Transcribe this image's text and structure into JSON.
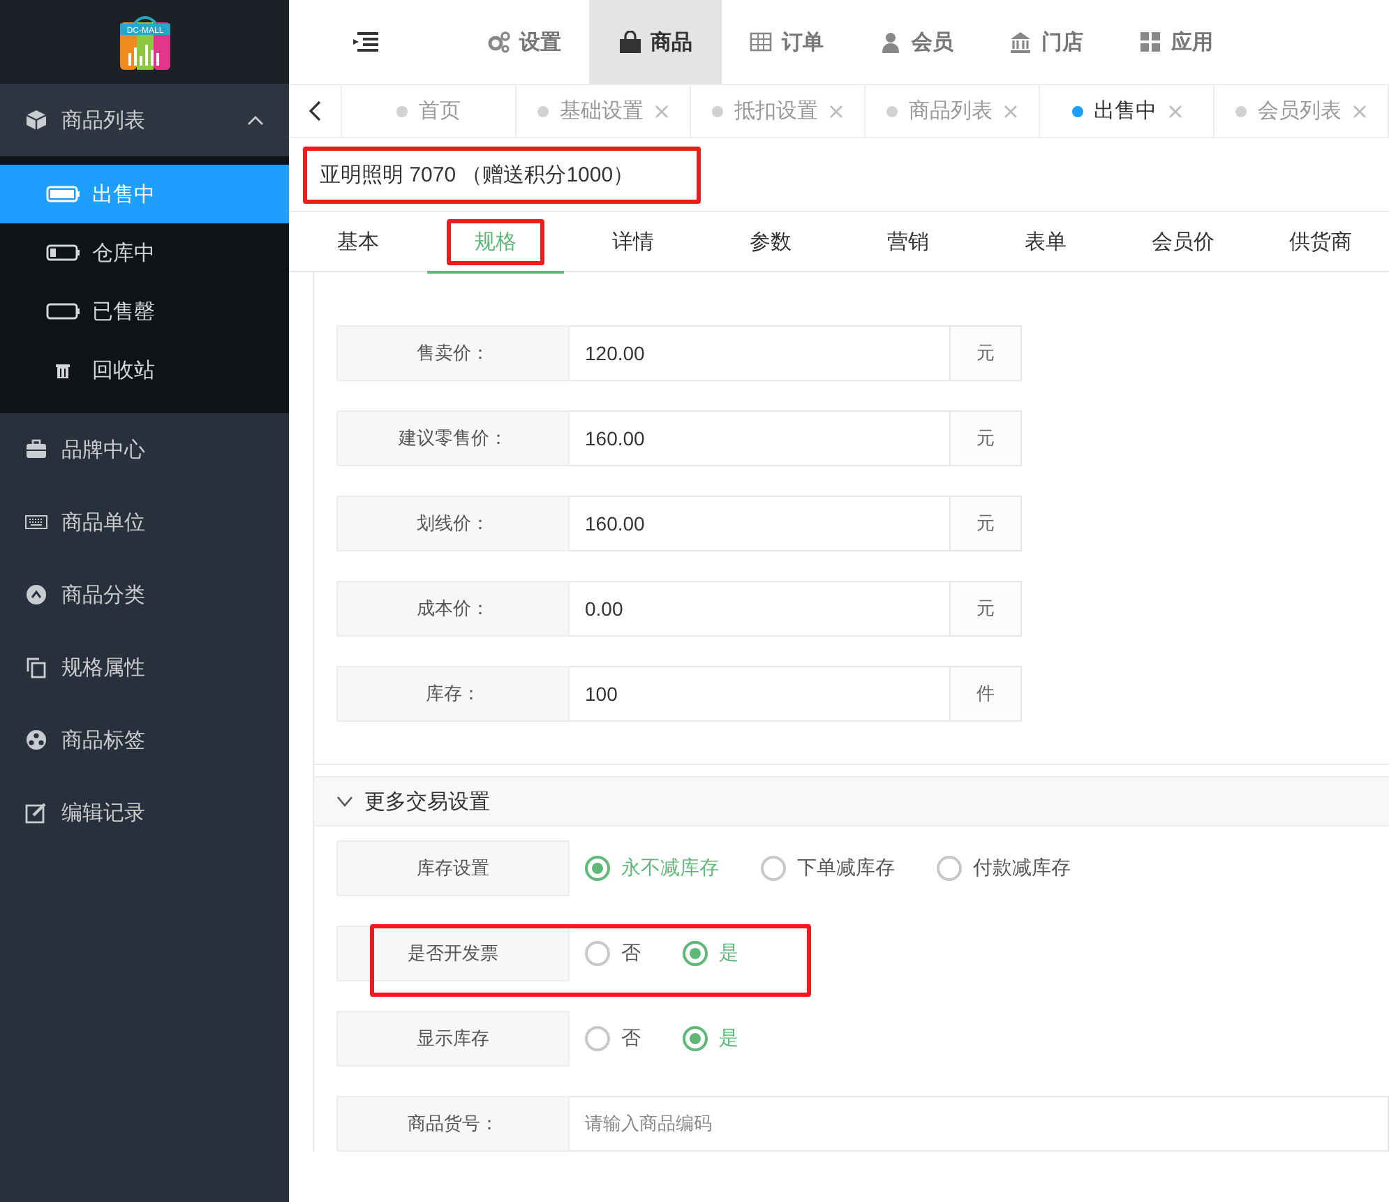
{
  "logo": {
    "text": "DC-MALL"
  },
  "sidebar": {
    "items": [
      {
        "label": "商品列表",
        "expanded": true,
        "children": [
          {
            "label": "出售中",
            "selected": true
          },
          {
            "label": "仓库中",
            "selected": false
          },
          {
            "label": "已售罄",
            "selected": false
          },
          {
            "label": "回收站",
            "selected": false
          }
        ]
      },
      {
        "label": "品牌中心"
      },
      {
        "label": "商品单位"
      },
      {
        "label": "商品分类"
      },
      {
        "label": "规格属性"
      },
      {
        "label": "商品标签"
      },
      {
        "label": "编辑记录"
      }
    ]
  },
  "top_nav": {
    "items": [
      {
        "label": "设置",
        "selected": false
      },
      {
        "label": "商品",
        "selected": true
      },
      {
        "label": "订单",
        "selected": false
      },
      {
        "label": "会员",
        "selected": false
      },
      {
        "label": "门店",
        "selected": false
      },
      {
        "label": "应用",
        "selected": false
      }
    ]
  },
  "page_tabs": [
    {
      "label": "首页",
      "selected": false,
      "closable": false
    },
    {
      "label": "基础设置",
      "selected": false,
      "closable": true
    },
    {
      "label": "抵扣设置",
      "selected": false,
      "closable": true
    },
    {
      "label": "商品列表",
      "selected": false,
      "closable": true
    },
    {
      "label": "出售中",
      "selected": true,
      "closable": true
    },
    {
      "label": "会员列表",
      "selected": false,
      "closable": true
    }
  ],
  "product_title": {
    "text": "亚明照明 7070 （赠送积分1000）",
    "highlighted": true
  },
  "section_tabs": [
    {
      "label": "基本",
      "selected": false,
      "highlighted": false
    },
    {
      "label": "规格",
      "selected": true,
      "highlighted": true
    },
    {
      "label": "详情",
      "selected": false,
      "highlighted": false
    },
    {
      "label": "参数",
      "selected": false,
      "highlighted": false
    },
    {
      "label": "营销",
      "selected": false,
      "highlighted": false
    },
    {
      "label": "表单",
      "selected": false,
      "highlighted": false
    },
    {
      "label": "会员价",
      "selected": false,
      "highlighted": false
    },
    {
      "label": "供货商",
      "selected": false,
      "highlighted": false
    }
  ],
  "price_fields": [
    {
      "label": "售卖价：",
      "value": "120.00",
      "unit": "元"
    },
    {
      "label": "建议零售价：",
      "value": "160.00",
      "unit": "元"
    },
    {
      "label": "划线价：",
      "value": "160.00",
      "unit": "元"
    },
    {
      "label": "成本价：",
      "value": "0.00",
      "unit": "元"
    },
    {
      "label": "库存：",
      "value": "100",
      "unit": "件"
    }
  ],
  "more_settings": {
    "title": "更多交易设置",
    "expanded": true,
    "rows": [
      {
        "kind": "radio",
        "label": "库存设置",
        "highlighted": false,
        "options": [
          {
            "label": "永不减库存",
            "selected": true
          },
          {
            "label": "下单减库存",
            "selected": false
          },
          {
            "label": "付款减库存",
            "selected": false
          }
        ]
      },
      {
        "kind": "radio",
        "label": "是否开发票",
        "highlighted": true,
        "options": [
          {
            "label": "否",
            "selected": false
          },
          {
            "label": "是",
            "selected": true
          }
        ]
      },
      {
        "kind": "radio",
        "label": "显示库存",
        "highlighted": false,
        "options": [
          {
            "label": "否",
            "selected": false
          },
          {
            "label": "是",
            "selected": true
          }
        ]
      },
      {
        "kind": "input",
        "label": "商品货号：",
        "placeholder": "请输入商品编码",
        "highlighted": false
      }
    ]
  }
}
